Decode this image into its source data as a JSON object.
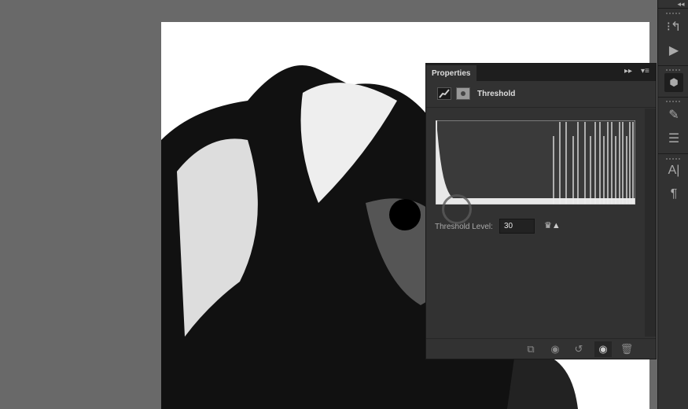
{
  "properties_panel": {
    "tab_label": "Properties",
    "title": "Threshold",
    "threshold_label": "Threshold Level:",
    "threshold_value": "30",
    "menu_icons": [
      "collapse-icon",
      "panel-menu-icon"
    ],
    "footer_icons": [
      "clip-to-layer-icon",
      "view-previous-state-icon",
      "reset-icon",
      "visibility-icon",
      "delete-icon"
    ]
  },
  "dock": {
    "icons": [
      "collapse-dock-icon",
      "history-icon",
      "actions-icon",
      "properties-icon",
      "brush-icon",
      "brush-presets-icon",
      "character-icon",
      "paragraph-icon"
    ]
  }
}
